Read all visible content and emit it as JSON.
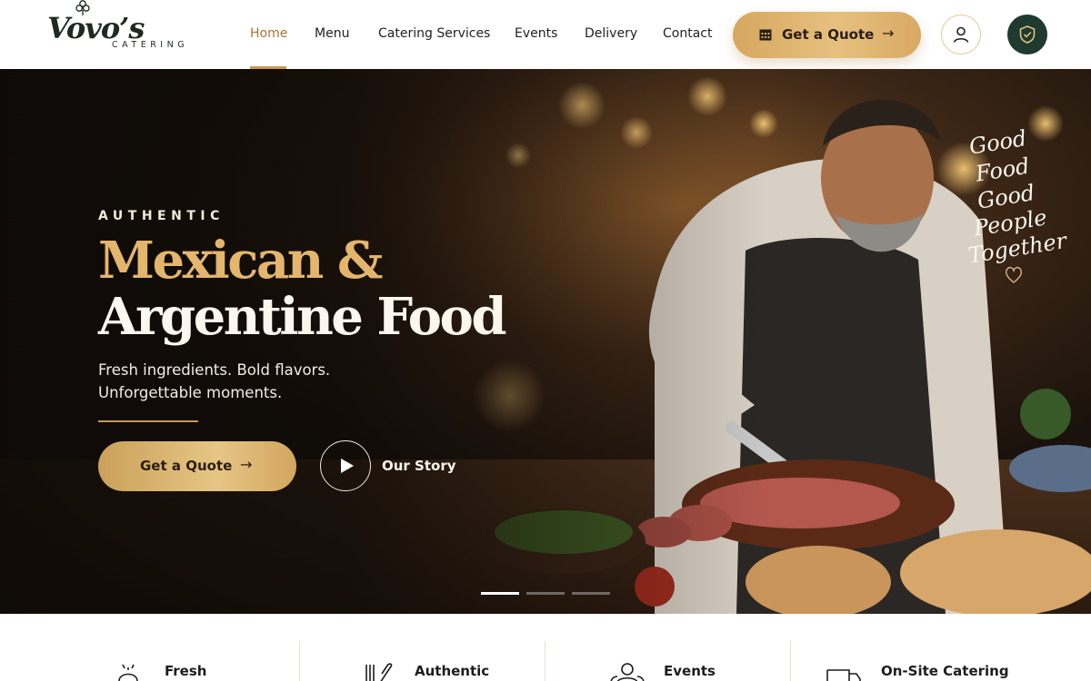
{
  "brand": {
    "name": "Vovo’s",
    "tagline": "CATERING"
  },
  "nav": {
    "items": [
      {
        "label": "Home",
        "active": true
      },
      {
        "label": "Menu",
        "active": false
      },
      {
        "label": "Catering Services",
        "active": false
      },
      {
        "label": "Events",
        "active": false
      },
      {
        "label": "Delivery",
        "active": false
      },
      {
        "label": "Contact",
        "active": false
      }
    ]
  },
  "header": {
    "quote_label": "Get a Quote",
    "quote_arrow": "→",
    "icons": {
      "calendar": "calendar-icon",
      "user": "user-icon",
      "shield": "shield-check-icon"
    }
  },
  "hero": {
    "kicker": "AUTHENTIC",
    "title_line1": "Mexican &",
    "title_line2": "Argentine Food",
    "subtitle_line1": "Fresh ingredients. Bold flavors.",
    "subtitle_line2": "Unforgettable moments.",
    "cta_label": "Get a Quote",
    "cta_arrow": "→",
    "play_icon": "play-icon",
    "story_label": "Our Story",
    "script_lines": [
      "Good",
      "Food",
      "Good",
      "People",
      "Together"
    ],
    "slides": {
      "count": 3,
      "active": 1
    }
  },
  "features": [
    {
      "label": "Fresh",
      "icon": "dish-cloche-icon"
    },
    {
      "label": "Authentic",
      "icon": "utensils-icon"
    },
    {
      "label": "Events",
      "icon": "people-icon"
    },
    {
      "label": "On-Site Catering",
      "icon": "truck-icon"
    }
  ],
  "colors": {
    "accent_gold": "#c99a4f",
    "dark_green": "#1f3a2e",
    "hero_title_gold": "#e4b56c"
  }
}
